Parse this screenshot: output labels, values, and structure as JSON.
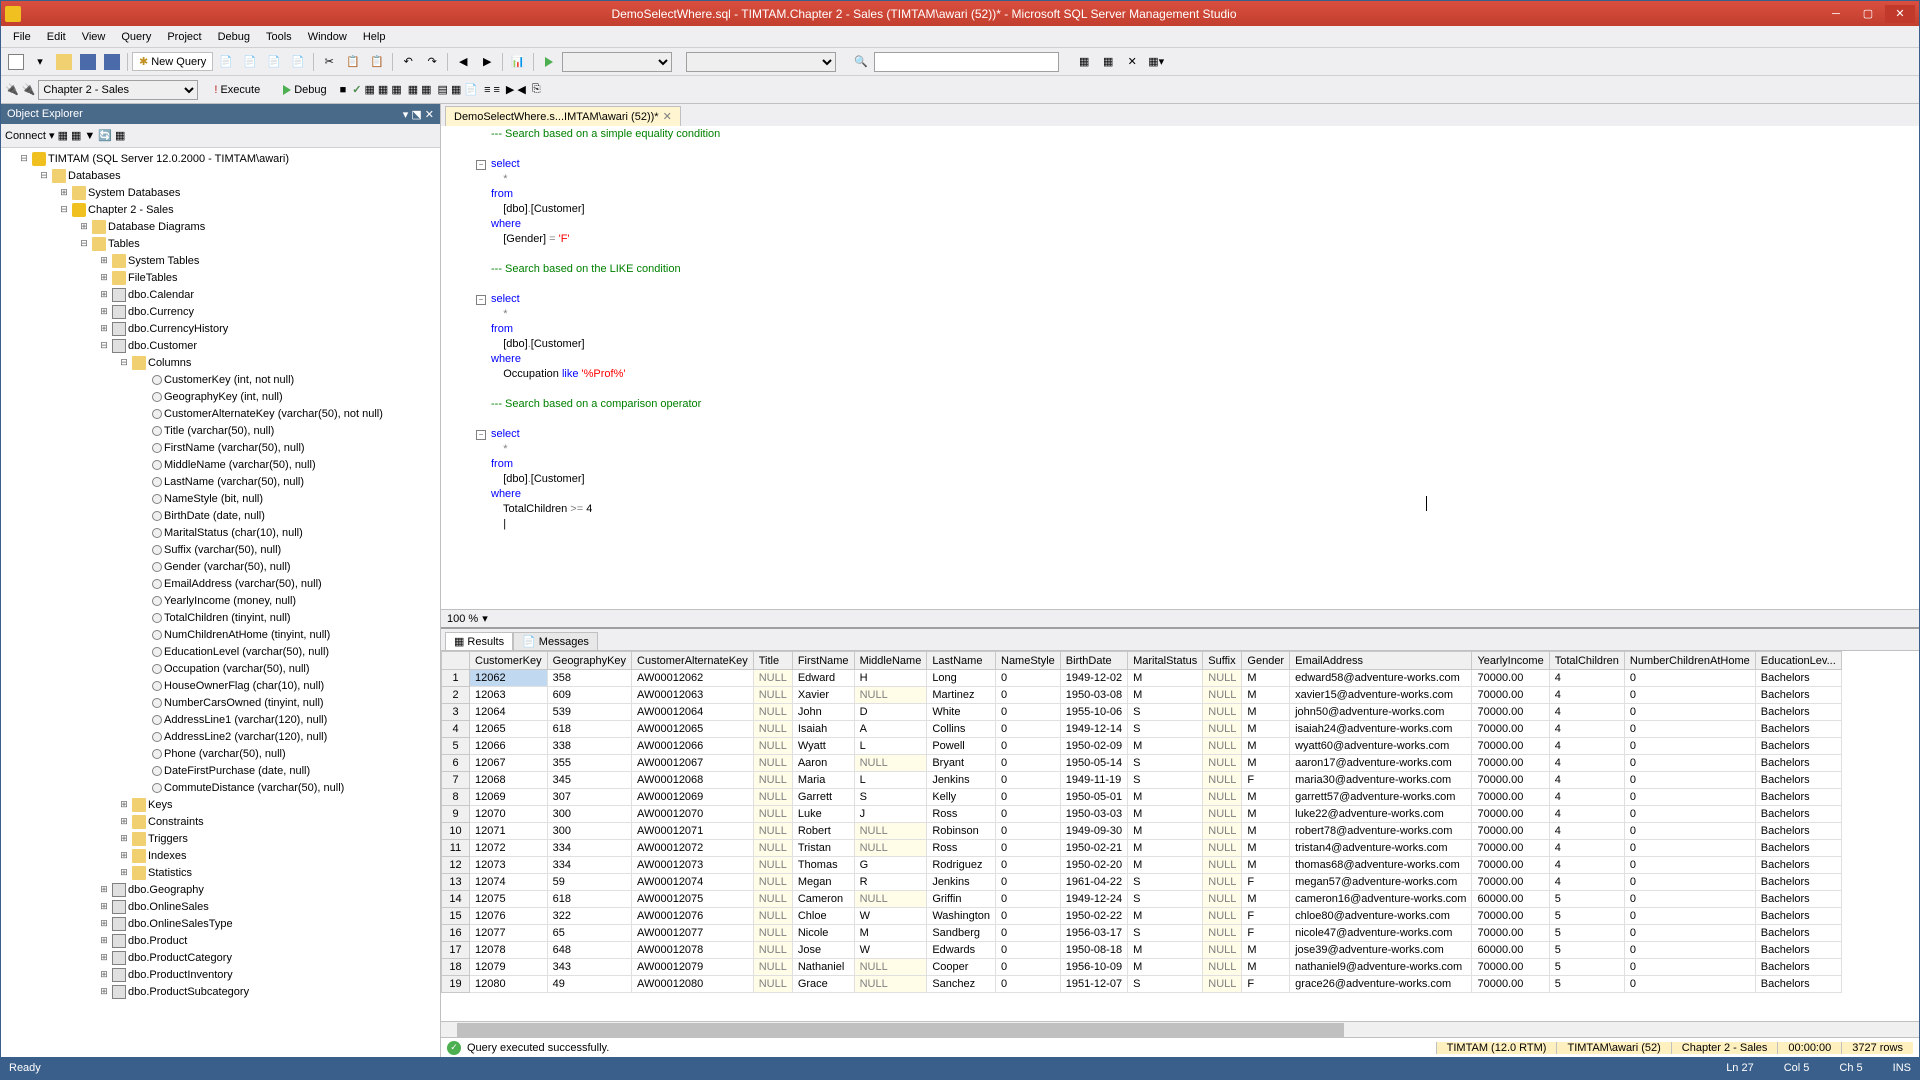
{
  "title": "DemoSelectWhere.sql - TIMTAM.Chapter 2 - Sales  (TIMTAM\\awari (52))* - Microsoft SQL Server Management Studio",
  "menu": [
    "File",
    "Edit",
    "View",
    "Query",
    "Project",
    "Debug",
    "Tools",
    "Window",
    "Help"
  ],
  "toolbar": {
    "new_query": "New Query"
  },
  "toolbar2": {
    "db": "Chapter 2 - Sales",
    "execute": "Execute",
    "debug": "Debug"
  },
  "objexp": {
    "title": "Object Explorer",
    "connect": "Connect ▾",
    "server": "TIMTAM (SQL Server 12.0.2000 - TIMTAM\\awari)",
    "nodes": [
      {
        "pad": 15,
        "exp": "-",
        "icon": "db",
        "label": "TIMTAM (SQL Server 12.0.2000 - TIMTAM\\awari)"
      },
      {
        "pad": 35,
        "exp": "-",
        "icon": "folder",
        "label": "Databases"
      },
      {
        "pad": 55,
        "exp": "+",
        "icon": "folder",
        "label": "System Databases"
      },
      {
        "pad": 55,
        "exp": "-",
        "icon": "db",
        "label": "Chapter 2 - Sales"
      },
      {
        "pad": 75,
        "exp": "+",
        "icon": "folder",
        "label": "Database Diagrams"
      },
      {
        "pad": 75,
        "exp": "-",
        "icon": "folder",
        "label": "Tables"
      },
      {
        "pad": 95,
        "exp": "+",
        "icon": "folder",
        "label": "System Tables"
      },
      {
        "pad": 95,
        "exp": "+",
        "icon": "folder",
        "label": "FileTables"
      },
      {
        "pad": 95,
        "exp": "+",
        "icon": "table",
        "label": "dbo.Calendar"
      },
      {
        "pad": 95,
        "exp": "+",
        "icon": "table",
        "label": "dbo.Currency"
      },
      {
        "pad": 95,
        "exp": "+",
        "icon": "table",
        "label": "dbo.CurrencyHistory"
      },
      {
        "pad": 95,
        "exp": "-",
        "icon": "table",
        "label": "dbo.Customer"
      },
      {
        "pad": 115,
        "exp": "-",
        "icon": "folder",
        "label": "Columns"
      },
      {
        "pad": 135,
        "exp": "",
        "icon": "col",
        "label": "CustomerKey (int, not null)"
      },
      {
        "pad": 135,
        "exp": "",
        "icon": "col",
        "label": "GeographyKey (int, null)"
      },
      {
        "pad": 135,
        "exp": "",
        "icon": "col",
        "label": "CustomerAlternateKey (varchar(50), not null)"
      },
      {
        "pad": 135,
        "exp": "",
        "icon": "col",
        "label": "Title (varchar(50), null)"
      },
      {
        "pad": 135,
        "exp": "",
        "icon": "col",
        "label": "FirstName (varchar(50), null)"
      },
      {
        "pad": 135,
        "exp": "",
        "icon": "col",
        "label": "MiddleName (varchar(50), null)"
      },
      {
        "pad": 135,
        "exp": "",
        "icon": "col",
        "label": "LastName (varchar(50), null)"
      },
      {
        "pad": 135,
        "exp": "",
        "icon": "col",
        "label": "NameStyle (bit, null)"
      },
      {
        "pad": 135,
        "exp": "",
        "icon": "col",
        "label": "BirthDate (date, null)"
      },
      {
        "pad": 135,
        "exp": "",
        "icon": "col",
        "label": "MaritalStatus (char(10), null)"
      },
      {
        "pad": 135,
        "exp": "",
        "icon": "col",
        "label": "Suffix (varchar(50), null)"
      },
      {
        "pad": 135,
        "exp": "",
        "icon": "col",
        "label": "Gender (varchar(50), null)"
      },
      {
        "pad": 135,
        "exp": "",
        "icon": "col",
        "label": "EmailAddress (varchar(50), null)"
      },
      {
        "pad": 135,
        "exp": "",
        "icon": "col",
        "label": "YearlyIncome (money, null)"
      },
      {
        "pad": 135,
        "exp": "",
        "icon": "col",
        "label": "TotalChildren (tinyint, null)"
      },
      {
        "pad": 135,
        "exp": "",
        "icon": "col",
        "label": "NumChildrenAtHome (tinyint, null)"
      },
      {
        "pad": 135,
        "exp": "",
        "icon": "col",
        "label": "EducationLevel (varchar(50), null)"
      },
      {
        "pad": 135,
        "exp": "",
        "icon": "col",
        "label": "Occupation (varchar(50), null)"
      },
      {
        "pad": 135,
        "exp": "",
        "icon": "col",
        "label": "HouseOwnerFlag (char(10), null)"
      },
      {
        "pad": 135,
        "exp": "",
        "icon": "col",
        "label": "NumberCarsOwned (tinyint, null)"
      },
      {
        "pad": 135,
        "exp": "",
        "icon": "col",
        "label": "AddressLine1 (varchar(120), null)"
      },
      {
        "pad": 135,
        "exp": "",
        "icon": "col",
        "label": "AddressLine2 (varchar(120), null)"
      },
      {
        "pad": 135,
        "exp": "",
        "icon": "col",
        "label": "Phone (varchar(50), null)"
      },
      {
        "pad": 135,
        "exp": "",
        "icon": "col",
        "label": "DateFirstPurchase (date, null)"
      },
      {
        "pad": 135,
        "exp": "",
        "icon": "col",
        "label": "CommuteDistance (varchar(50), null)"
      },
      {
        "pad": 115,
        "exp": "+",
        "icon": "folder",
        "label": "Keys"
      },
      {
        "pad": 115,
        "exp": "+",
        "icon": "folder",
        "label": "Constraints"
      },
      {
        "pad": 115,
        "exp": "+",
        "icon": "folder",
        "label": "Triggers"
      },
      {
        "pad": 115,
        "exp": "+",
        "icon": "folder",
        "label": "Indexes"
      },
      {
        "pad": 115,
        "exp": "+",
        "icon": "folder",
        "label": "Statistics"
      },
      {
        "pad": 95,
        "exp": "+",
        "icon": "table",
        "label": "dbo.Geography"
      },
      {
        "pad": 95,
        "exp": "+",
        "icon": "table",
        "label": "dbo.OnlineSales"
      },
      {
        "pad": 95,
        "exp": "+",
        "icon": "table",
        "label": "dbo.OnlineSalesType"
      },
      {
        "pad": 95,
        "exp": "+",
        "icon": "table",
        "label": "dbo.Product"
      },
      {
        "pad": 95,
        "exp": "+",
        "icon": "table",
        "label": "dbo.ProductCategory"
      },
      {
        "pad": 95,
        "exp": "+",
        "icon": "table",
        "label": "dbo.ProductInventory"
      },
      {
        "pad": 95,
        "exp": "+",
        "icon": "table",
        "label": "dbo.ProductSubcategory"
      }
    ]
  },
  "editor": {
    "tab": "DemoSelectWhere.s...IMTAM\\awari (52))*",
    "zoom": "100 %"
  },
  "results": {
    "tabs": [
      "Results",
      "Messages"
    ],
    "cols": [
      "CustomerKey",
      "GeographyKey",
      "CustomerAlternateKey",
      "Title",
      "FirstName",
      "MiddleName",
      "LastName",
      "NameStyle",
      "BirthDate",
      "MaritalStatus",
      "Suffix",
      "Gender",
      "EmailAddress",
      "YearlyIncome",
      "TotalChildren",
      "NumberChildrenAtHome",
      "EducationLev..."
    ],
    "rows": [
      [
        "12062",
        "358",
        "AW00012062",
        "NULL",
        "Edward",
        "H",
        "Long",
        "0",
        "1949-12-02",
        "M",
        "NULL",
        "M",
        "edward58@adventure-works.com",
        "70000.00",
        "4",
        "0",
        "Bachelors"
      ],
      [
        "12063",
        "609",
        "AW00012063",
        "NULL",
        "Xavier",
        "NULL",
        "Martinez",
        "0",
        "1950-03-08",
        "M",
        "NULL",
        "M",
        "xavier15@adventure-works.com",
        "70000.00",
        "4",
        "0",
        "Bachelors"
      ],
      [
        "12064",
        "539",
        "AW00012064",
        "NULL",
        "John",
        "D",
        "White",
        "0",
        "1955-10-06",
        "S",
        "NULL",
        "M",
        "john50@adventure-works.com",
        "70000.00",
        "4",
        "0",
        "Bachelors"
      ],
      [
        "12065",
        "618",
        "AW00012065",
        "NULL",
        "Isaiah",
        "A",
        "Collins",
        "0",
        "1949-12-14",
        "S",
        "NULL",
        "M",
        "isaiah24@adventure-works.com",
        "70000.00",
        "4",
        "0",
        "Bachelors"
      ],
      [
        "12066",
        "338",
        "AW00012066",
        "NULL",
        "Wyatt",
        "L",
        "Powell",
        "0",
        "1950-02-09",
        "M",
        "NULL",
        "M",
        "wyatt60@adventure-works.com",
        "70000.00",
        "4",
        "0",
        "Bachelors"
      ],
      [
        "12067",
        "355",
        "AW00012067",
        "NULL",
        "Aaron",
        "NULL",
        "Bryant",
        "0",
        "1950-05-14",
        "S",
        "NULL",
        "M",
        "aaron17@adventure-works.com",
        "70000.00",
        "4",
        "0",
        "Bachelors"
      ],
      [
        "12068",
        "345",
        "AW00012068",
        "NULL",
        "Maria",
        "L",
        "Jenkins",
        "0",
        "1949-11-19",
        "S",
        "NULL",
        "F",
        "maria30@adventure-works.com",
        "70000.00",
        "4",
        "0",
        "Bachelors"
      ],
      [
        "12069",
        "307",
        "AW00012069",
        "NULL",
        "Garrett",
        "S",
        "Kelly",
        "0",
        "1950-05-01",
        "M",
        "NULL",
        "M",
        "garrett57@adventure-works.com",
        "70000.00",
        "4",
        "0",
        "Bachelors"
      ],
      [
        "12070",
        "300",
        "AW00012070",
        "NULL",
        "Luke",
        "J",
        "Ross",
        "0",
        "1950-03-03",
        "M",
        "NULL",
        "M",
        "luke22@adventure-works.com",
        "70000.00",
        "4",
        "0",
        "Bachelors"
      ],
      [
        "12071",
        "300",
        "AW00012071",
        "NULL",
        "Robert",
        "NULL",
        "Robinson",
        "0",
        "1949-09-30",
        "M",
        "NULL",
        "M",
        "robert78@adventure-works.com",
        "70000.00",
        "4",
        "0",
        "Bachelors"
      ],
      [
        "12072",
        "334",
        "AW00012072",
        "NULL",
        "Tristan",
        "NULL",
        "Ross",
        "0",
        "1950-02-21",
        "M",
        "NULL",
        "M",
        "tristan4@adventure-works.com",
        "70000.00",
        "4",
        "0",
        "Bachelors"
      ],
      [
        "12073",
        "334",
        "AW00012073",
        "NULL",
        "Thomas",
        "G",
        "Rodriguez",
        "0",
        "1950-02-20",
        "M",
        "NULL",
        "M",
        "thomas68@adventure-works.com",
        "70000.00",
        "4",
        "0",
        "Bachelors"
      ],
      [
        "12074",
        "59",
        "AW00012074",
        "NULL",
        "Megan",
        "R",
        "Jenkins",
        "0",
        "1961-04-22",
        "S",
        "NULL",
        "F",
        "megan57@adventure-works.com",
        "70000.00",
        "4",
        "0",
        "Bachelors"
      ],
      [
        "12075",
        "618",
        "AW00012075",
        "NULL",
        "Cameron",
        "NULL",
        "Griffin",
        "0",
        "1949-12-24",
        "S",
        "NULL",
        "M",
        "cameron16@adventure-works.com",
        "60000.00",
        "5",
        "0",
        "Bachelors"
      ],
      [
        "12076",
        "322",
        "AW00012076",
        "NULL",
        "Chloe",
        "W",
        "Washington",
        "0",
        "1950-02-22",
        "M",
        "NULL",
        "F",
        "chloe80@adventure-works.com",
        "70000.00",
        "5",
        "0",
        "Bachelors"
      ],
      [
        "12077",
        "65",
        "AW00012077",
        "NULL",
        "Nicole",
        "M",
        "Sandberg",
        "0",
        "1956-03-17",
        "S",
        "NULL",
        "F",
        "nicole47@adventure-works.com",
        "70000.00",
        "5",
        "0",
        "Bachelors"
      ],
      [
        "12078",
        "648",
        "AW00012078",
        "NULL",
        "Jose",
        "W",
        "Edwards",
        "0",
        "1950-08-18",
        "M",
        "NULL",
        "M",
        "jose39@adventure-works.com",
        "60000.00",
        "5",
        "0",
        "Bachelors"
      ],
      [
        "12079",
        "343",
        "AW00012079",
        "NULL",
        "Nathaniel",
        "NULL",
        "Cooper",
        "0",
        "1956-10-09",
        "M",
        "NULL",
        "M",
        "nathaniel9@adventure-works.com",
        "70000.00",
        "5",
        "0",
        "Bachelors"
      ],
      [
        "12080",
        "49",
        "AW00012080",
        "NULL",
        "Grace",
        "NULL",
        "Sanchez",
        "0",
        "1951-12-07",
        "S",
        "NULL",
        "F",
        "grace26@adventure-works.com",
        "70000.00",
        "5",
        "0",
        "Bachelors"
      ]
    ]
  },
  "status": {
    "msg": "Query executed successfully.",
    "server": "TIMTAM (12.0 RTM)",
    "user": "TIMTAM\\awari (52)",
    "db": "Chapter 2 - Sales",
    "time": "00:00:00",
    "rows": "3727 rows",
    "ready": "Ready",
    "ln": "Ln 27",
    "col": "Col 5",
    "ch": "Ch 5",
    "ins": "INS"
  }
}
